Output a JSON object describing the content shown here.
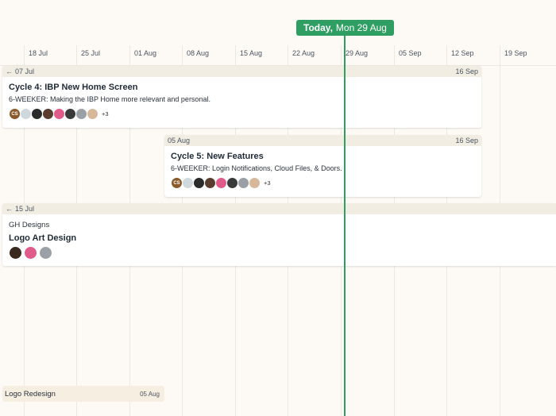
{
  "today": {
    "bold": "Today,",
    "date": "Mon 29 Aug"
  },
  "ticks": [
    "18 Jul",
    "25 Jul",
    "01 Aug",
    "08 Aug",
    "15 Aug",
    "22 Aug",
    "29 Aug",
    "05 Sep",
    "12 Sep",
    "19 Sep"
  ],
  "cards": [
    {
      "start_label": "07 Jul",
      "end_label": "16 Sep",
      "title": "Cycle 4: IBP New Home Screen",
      "description": "6-WEEKER: Making the IBP Home more relevant and personal.",
      "more": "+3"
    },
    {
      "start_label": "05 Aug",
      "end_label": "16 Sep",
      "title": "Cycle 5: New Features",
      "description": "6-WEEKER: Login Notifications, Cloud Files, & Doors.",
      "more": "+3"
    },
    {
      "start_label": "15 Jul",
      "end_label": "",
      "team": "GH Designs",
      "title": "Logo Art Design"
    }
  ],
  "bottom_item": {
    "title": "Logo Redesign",
    "date": "05 Aug"
  },
  "avatar_initials": "CS",
  "colors": {
    "today_green": "#2f9e63",
    "card_header": "#f2ede3",
    "background": "#fdf9f5"
  },
  "icons": {
    "arrow": "left-arrow-icon"
  }
}
